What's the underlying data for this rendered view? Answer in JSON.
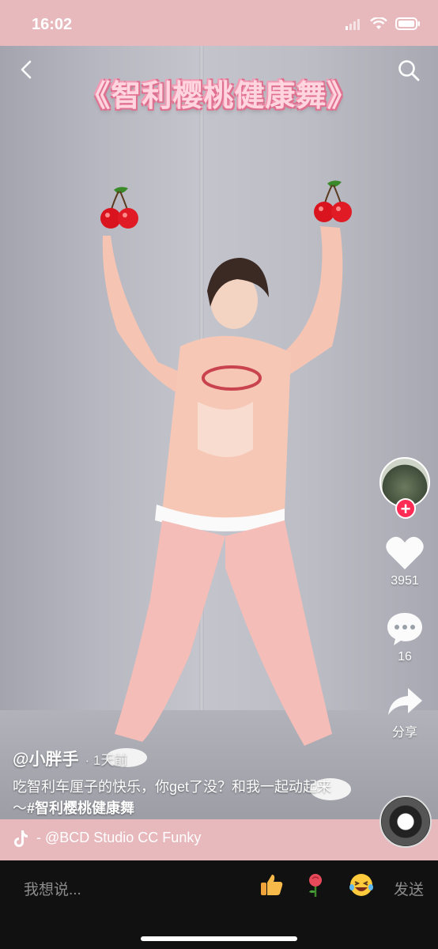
{
  "status_bar": {
    "time": "16:02",
    "signal_icon": "cellular-signal-icon",
    "wifi_icon": "wifi-icon",
    "battery_icon": "battery-icon"
  },
  "video": {
    "title": "《智利樱桃健康舞》",
    "back_icon": "back-arrow-icon",
    "search_icon": "search-icon",
    "sticker_icon": "cherry-icon"
  },
  "right_rail": {
    "follow_icon": "plus-icon",
    "likes": "3951",
    "comments": "16",
    "share_label": "分享",
    "like_icon": "heart-icon",
    "comment_icon": "comment-bubble-icon",
    "share_icon": "share-arrow-icon"
  },
  "caption": {
    "author": "@小胖手",
    "time_ago": "· 1天前",
    "text": "吃智利车厘子的快乐，你get了没？和我一起动起来～",
    "hashtag": "#智利樱桃健康舞"
  },
  "music": {
    "icon": "tiktok-note-icon",
    "text": "- @BCD Studio CC    Funky"
  },
  "bottom_bar": {
    "placeholder": "我想说...",
    "quick_emojis": [
      "thumbs-up-icon",
      "rose-icon",
      "laughing-face-icon"
    ],
    "send_label": "发送"
  },
  "colors": {
    "status_bg": "#e7b9bd",
    "accent_red": "#fe2c55",
    "title_fill": "#ffd6e0",
    "title_outline": "#e0708f"
  }
}
